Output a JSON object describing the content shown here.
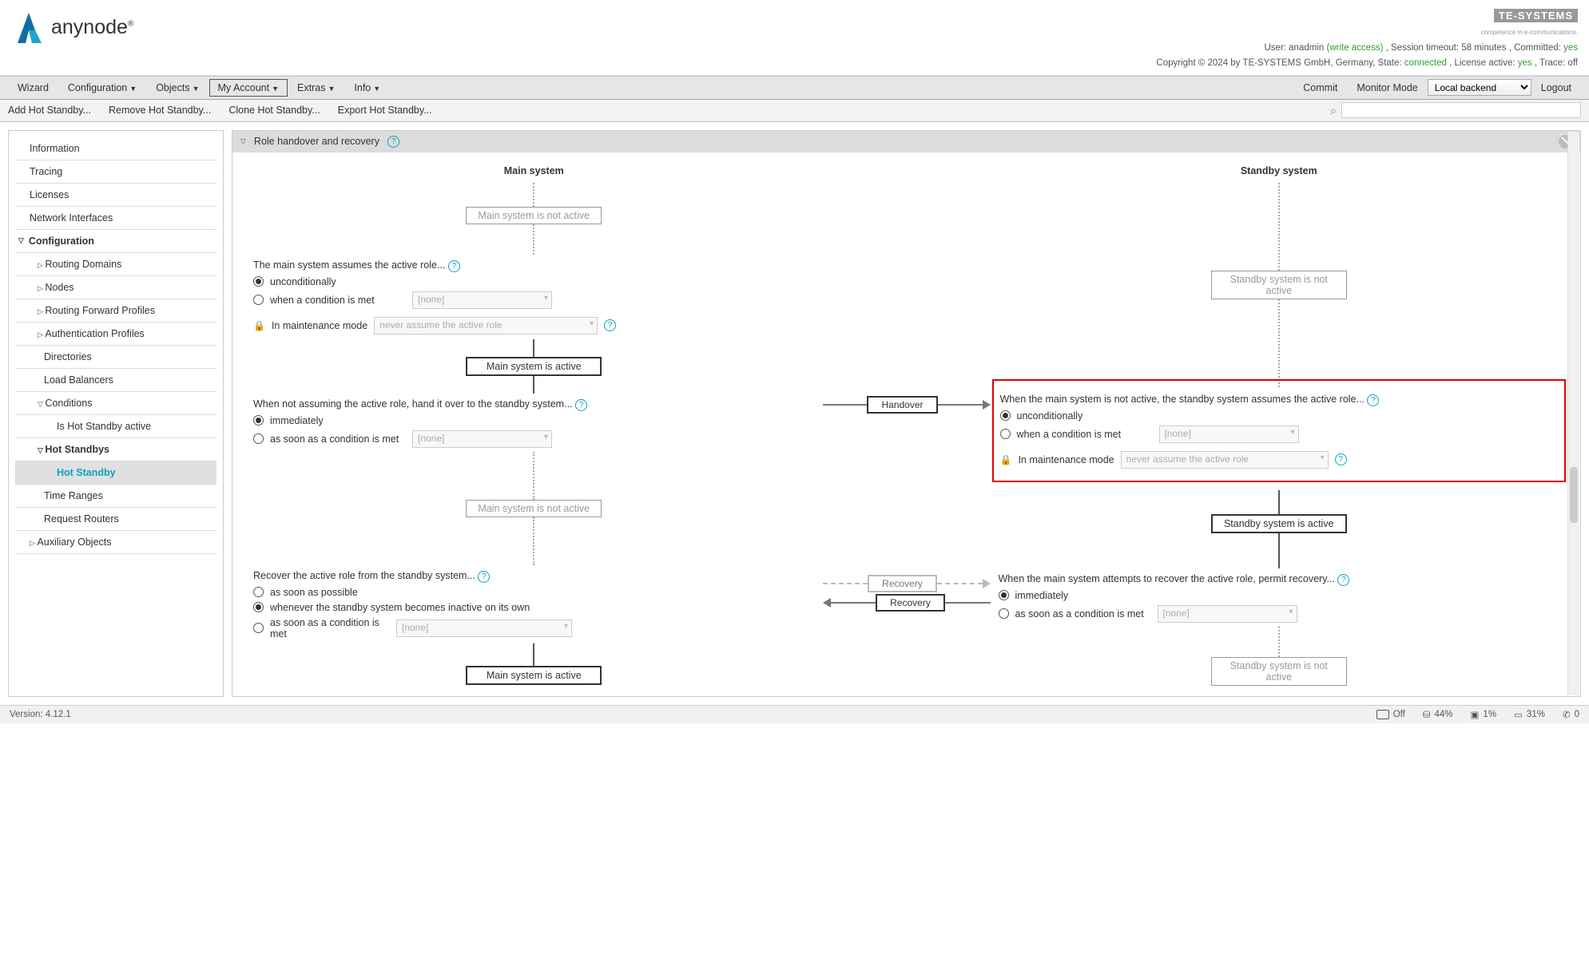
{
  "brand": {
    "name": "anynode",
    "reg": "®"
  },
  "header": {
    "user_label": "User:",
    "user": "anadmin",
    "access": "(write access)",
    "session_label": ", Session timeout:",
    "session": "58 minutes",
    "committed_label": ", Committed:",
    "committed": "yes",
    "copyright": "Copyright © 2024 by TE-SYSTEMS GmbH, Germany, State:",
    "state": "connected",
    "license_label": ", License active:",
    "license": "yes",
    "trace_label": ", Trace:",
    "trace": "off",
    "te_brand": "TE-SYSTEMS",
    "te_tag": "competence in e-communications."
  },
  "menu": {
    "wizard": "Wizard",
    "configuration": "Configuration",
    "objects": "Objects",
    "account": "My Account",
    "extras": "Extras",
    "info": "Info",
    "commit": "Commit",
    "monitor": "Monitor Mode",
    "backend": "Local backend",
    "logout": "Logout"
  },
  "submenu": {
    "add": "Add Hot Standby...",
    "remove": "Remove Hot Standby...",
    "clone": "Clone Hot Standby...",
    "export": "Export Hot Standby...",
    "search_placeholder": ""
  },
  "sidebar": {
    "information": "Information",
    "tracing": "Tracing",
    "licenses": "Licenses",
    "netif": "Network Interfaces",
    "configuration": "Configuration",
    "routing": "Routing Domains",
    "nodes": "Nodes",
    "rfp": "Routing Forward Profiles",
    "auth": "Authentication Profiles",
    "directories": "Directories",
    "lb": "Load Balancers",
    "conditions": "Conditions",
    "ishs": "Is Hot Standby active",
    "hotstandbys": "Hot Standbys",
    "hotstandby": "Hot Standby",
    "timeranges": "Time Ranges",
    "reqrouters": "Request Routers",
    "aux": "Auxiliary Objects"
  },
  "panel": {
    "title": "Role handover and recovery"
  },
  "main": {
    "title": "Main system",
    "notactive": "Main system is not active",
    "active": "Main system is active",
    "assume_q": "The main system assumes the active role...",
    "opt_uncond": "unconditionally",
    "opt_cond": "when a condition is met",
    "sel_none": "[none]",
    "maint_label": "In maintenance mode",
    "maint_value": "never assume the active role",
    "handover_q": "When not assuming the active role, hand it over to the standby system...",
    "opt_imm": "immediately",
    "opt_asap_cond": "as soon as a condition is met",
    "recover_q": "Recover the active role from the standby system...",
    "opt_asap": "as soon as possible",
    "opt_whenever": "whenever the standby system becomes inactive on its own"
  },
  "center": {
    "handover": "Handover",
    "recovery": "Recovery"
  },
  "standby": {
    "title": "Standby system",
    "notactive": "Standby system is not active",
    "active": "Standby system is active",
    "assume_q": "When the main system is not active, the standby system assumes the active role...",
    "opt_uncond": "unconditionally",
    "opt_cond": "when a condition is met",
    "sel_none": "[none]",
    "maint_label": "In maintenance mode",
    "maint_value": "never assume the active role",
    "permit_q": "When the main system attempts to recover the active role, permit recovery...",
    "opt_imm": "immediately",
    "opt_asap_cond": "as soon as a condition is met"
  },
  "footer": {
    "version_label": "Version:",
    "version": "4.12.1",
    "power": "Off",
    "disk": "44%",
    "cpu": "1%",
    "mem": "31%",
    "calls": "0"
  }
}
